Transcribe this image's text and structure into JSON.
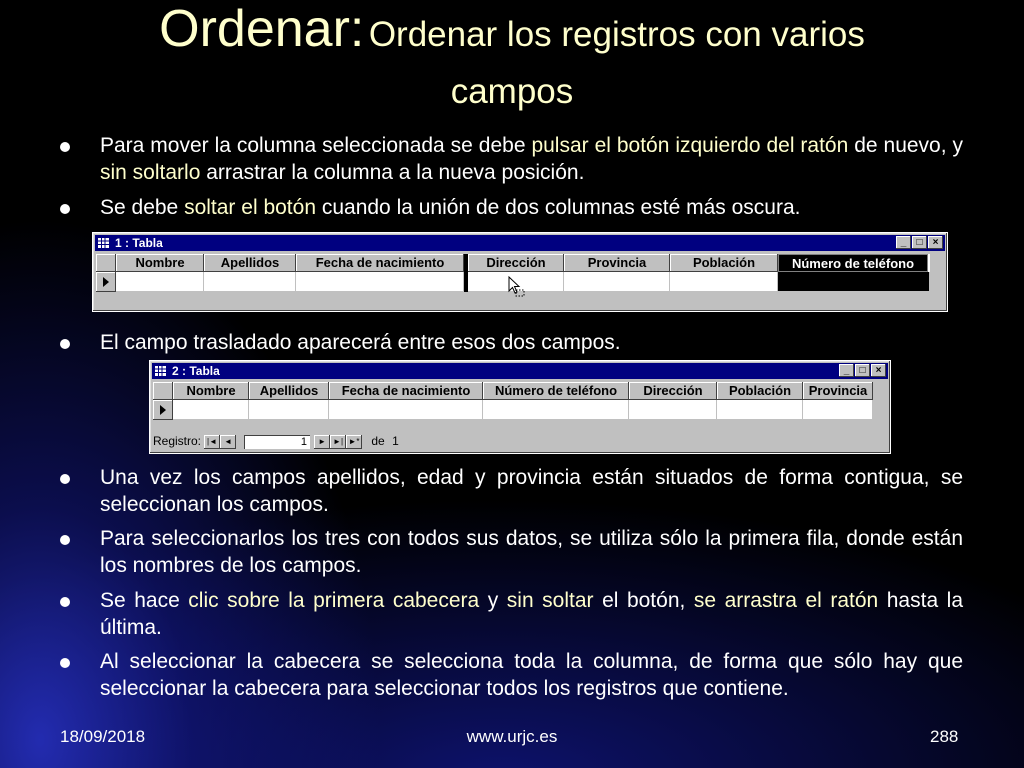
{
  "title": {
    "main": "Ordenar:",
    "sub_line1": "Ordenar los registros con varios",
    "sub_line2": "campos"
  },
  "bullets": [
    {
      "parts": [
        {
          "t": "Para mover la columna seleccionada se debe ",
          "hl": false
        },
        {
          "t": "pulsar el botón izquierdo del ratón",
          "hl": true
        },
        {
          "t": " de nuevo, y ",
          "hl": false
        },
        {
          "t": "sin soltarlo",
          "hl": true
        },
        {
          "t": " arrastrar la columna a la nueva posición.",
          "hl": false
        }
      ]
    },
    {
      "parts": [
        {
          "t": "Se debe ",
          "hl": false
        },
        {
          "t": "soltar el botón",
          "hl": true
        },
        {
          "t": " cuando la unión de dos columnas esté más oscura.",
          "hl": false
        }
      ]
    },
    {
      "parts": [
        {
          "t": "El campo trasladado aparecerá entre esos dos campos.",
          "hl": false
        }
      ]
    },
    {
      "parts": [
        {
          "t": "Una vez los campos apellidos, edad y provincia están situados de forma contigua, se seleccionan los campos.",
          "hl": false
        }
      ]
    },
    {
      "parts": [
        {
          "t": "Para seleccionarlos los tres con todos sus datos, se utiliza sólo la primera fila, donde están los nombres de los campos.",
          "hl": false
        }
      ]
    },
    {
      "parts": [
        {
          "t": "Se hace ",
          "hl": false
        },
        {
          "t": "clic sobre la primera cabecera",
          "hl": true
        },
        {
          "t": " y ",
          "hl": false
        },
        {
          "t": "sin soltar",
          "hl": true
        },
        {
          "t": " el botón, ",
          "hl": false
        },
        {
          "t": "se arrastra el ratón",
          "hl": true
        },
        {
          "t": " hasta la última.",
          "hl": false
        }
      ]
    },
    {
      "parts": [
        {
          "t": "Al seleccionar la cabecera se selecciona toda la columna, de forma que sólo hay que seleccionar la cabecera para seleccionar todos los registros que contiene.",
          "hl": false
        }
      ]
    }
  ],
  "window1": {
    "title": "1 : Tabla",
    "columns": [
      "Nombre",
      "Apellidos",
      "Fecha de nacimiento",
      "Dirección",
      "Provincia",
      "Población",
      "Número de teléfono"
    ],
    "selected_column": "Número de teléfono",
    "buttons": [
      "_",
      "□",
      "×"
    ]
  },
  "window2": {
    "title": "2 : Tabla",
    "columns": [
      "Nombre",
      "Apellidos",
      "Fecha de nacimiento",
      "Número de teléfono",
      "Dirección",
      "Población",
      "Provincia"
    ],
    "buttons": [
      "_",
      "□",
      "×"
    ],
    "nav": {
      "label": "Registro:",
      "current": "1",
      "of_label": "de",
      "total": "1",
      "btn_first": "|◄",
      "btn_prev": "◄",
      "btn_next": "►",
      "btn_last": "►|",
      "btn_new": "►*"
    }
  },
  "footer": {
    "date": "18/09/2018",
    "site": "www.urjc.es",
    "page": "288"
  },
  "colors": {
    "highlight": "#ffffcc",
    "titlebar": "#000080",
    "window_face": "#c0c0c0"
  }
}
